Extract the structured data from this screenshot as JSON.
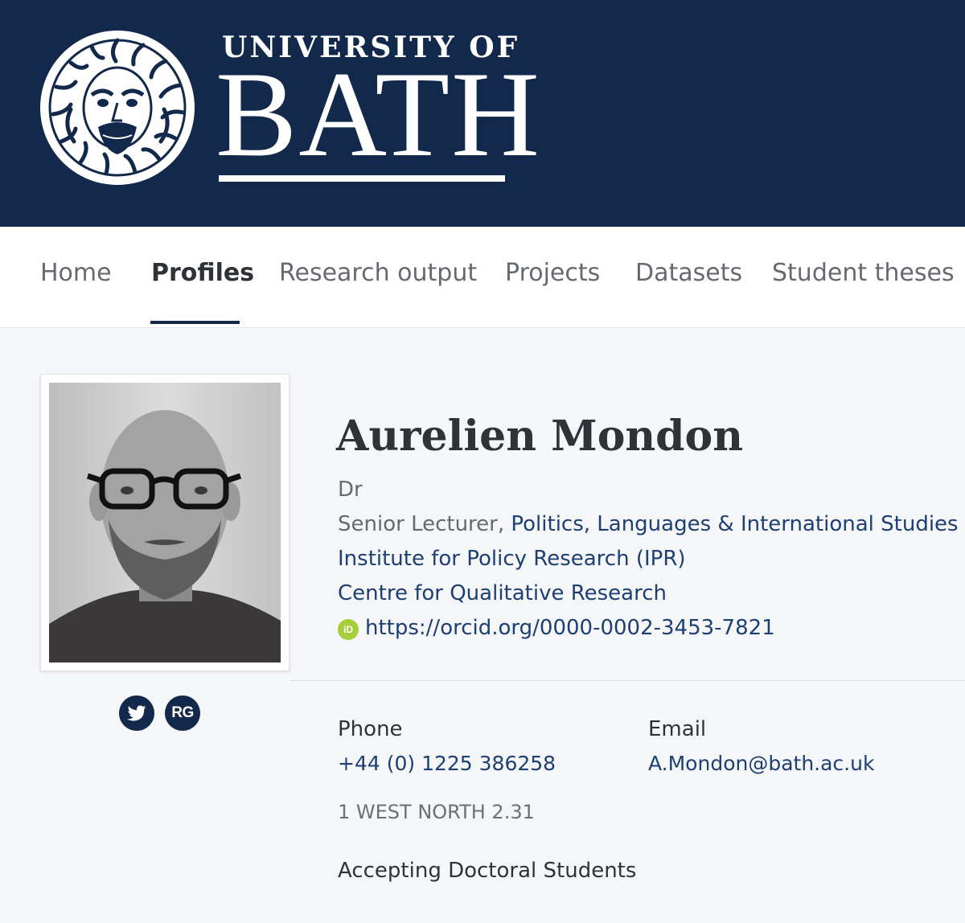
{
  "header": {
    "logo_line1": "UNIVERSITY OF",
    "logo_line2": "BATH",
    "background_color": "#13294b"
  },
  "nav": {
    "items": [
      {
        "label": "Home",
        "active": false
      },
      {
        "label": "Profiles",
        "active": true
      },
      {
        "label": "Research output",
        "active": false
      },
      {
        "label": "Projects",
        "active": false
      },
      {
        "label": "Datasets",
        "active": false
      },
      {
        "label": "Student theses",
        "active": false
      }
    ]
  },
  "profile": {
    "name": "Aurelien Mondon",
    "title": "Dr",
    "position": "Senior Lecturer,",
    "department": "Politics, Languages & International Studies",
    "affiliation1": "Institute for Policy Research (IPR)",
    "affiliation2": "Centre for Qualitative Research",
    "orcid_icon_text": "iD",
    "orcid_url": "https://orcid.org/0000-0002-3453-7821",
    "social": {
      "twitter_icon": "twitter-icon",
      "researchgate_label": "RG"
    }
  },
  "contact": {
    "phone_label": "Phone",
    "phone_value": "+44 (0) 1225 386258",
    "email_label": "Email",
    "email_value": "A.Mondon@bath.ac.uk",
    "office": "1 WEST NORTH 2.31",
    "accepting": "Accepting Doctoral Students"
  },
  "colors": {
    "brand_navy": "#13294b",
    "link": "#1d3f73",
    "orcid_green": "#a6ce39"
  }
}
